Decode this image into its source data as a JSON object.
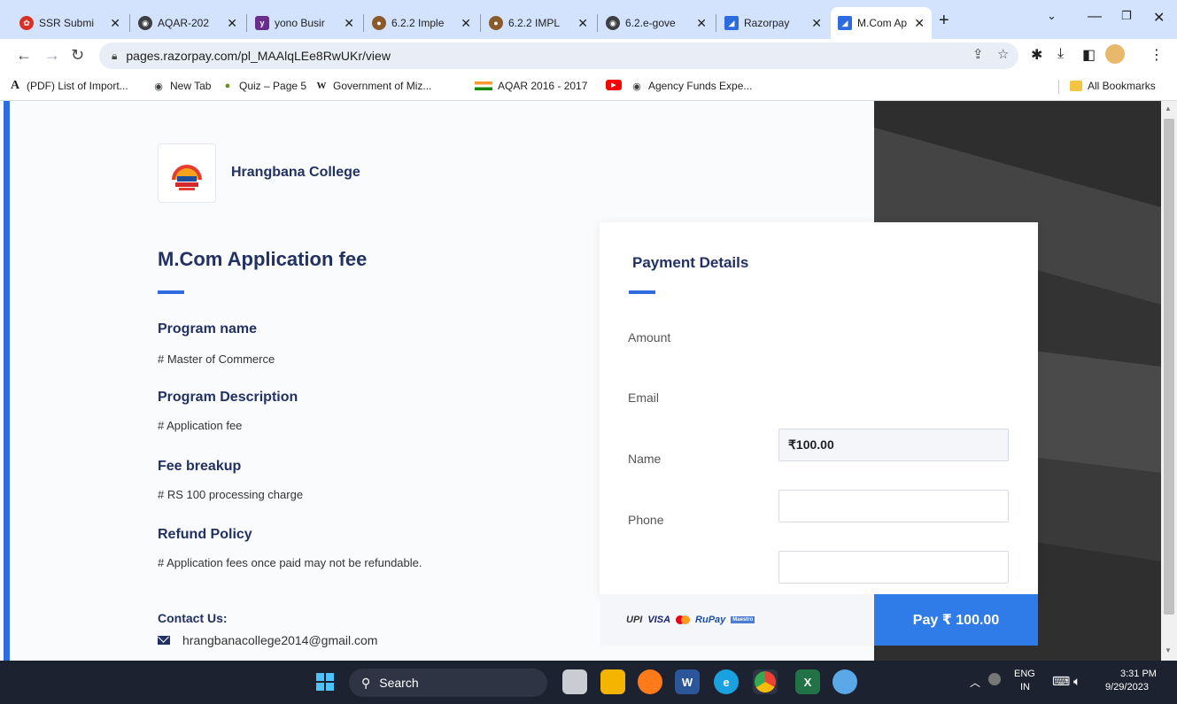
{
  "browser": {
    "tabs": [
      {
        "title": "SSR Submi",
        "color": "#d93025",
        "icon": "flower-icon"
      },
      {
        "title": "AQAR-202",
        "color": "#3c4043",
        "icon": "globe-icon"
      },
      {
        "title": "yono Busir",
        "color": "#6b2e8c",
        "icon": "yono-icon"
      },
      {
        "title": "6.2.2 Imple",
        "color": "#8a5a2b",
        "icon": "doc-icon"
      },
      {
        "title": "6.2.2 IMPL",
        "color": "#8a5a2b",
        "icon": "doc-icon"
      },
      {
        "title": "6.2.e-gove",
        "color": "#3c4043",
        "icon": "globe-icon"
      },
      {
        "title": "Razorpay",
        "color": "#2f6be0",
        "icon": "razorpay-icon"
      },
      {
        "title": "M.Com Ap",
        "color": "#2f6be0",
        "icon": "razorpay-icon"
      }
    ],
    "url": "pages.razorpay.com/pl_MAAlqLEe8RwUKr/view",
    "bookmarks": [
      {
        "label": "(PDF) List of Import...",
        "icon": "A"
      },
      {
        "label": "New Tab",
        "icon": "globe"
      },
      {
        "label": "Quiz – Page 5",
        "icon": "quiz"
      },
      {
        "label": "Government of Miz...",
        "icon": "W"
      },
      {
        "label": "AQAR 2016 - 2017",
        "icon": "flag"
      },
      {
        "label": "",
        "icon": "youtube"
      },
      {
        "label": "Agency Funds Expe...",
        "icon": "globe"
      }
    ],
    "all_bookmarks": "All Bookmarks"
  },
  "page": {
    "college_name": "Hrangbana College",
    "heading": "M.Com Application fee",
    "sections": [
      {
        "title": "Program name",
        "text": "# Master of Commerce"
      },
      {
        "title": "Program Description",
        "text": "# Application fee"
      },
      {
        "title": "Fee breakup",
        "text": "# RS 100 processing charge"
      },
      {
        "title": "Refund Policy",
        "text": "# Application fees once paid may not be refundable."
      }
    ],
    "contact_title": "Contact Us:",
    "contact_email": "hrangbanacollege2014@gmail.com"
  },
  "payment": {
    "title": "Payment Details",
    "amount_label": "Amount",
    "amount_value": "₹100.00",
    "email_label": "Email",
    "name_label": "Name",
    "phone_label": "Phone",
    "methods": [
      "UPI",
      "VISA",
      "RuPay",
      "Maestro"
    ],
    "pay_button": "Pay ₹ 100.00"
  },
  "taskbar": {
    "search": "Search",
    "lang": "ENG",
    "region": "IN",
    "time": "3:31 PM",
    "date": "9/29/2023"
  }
}
